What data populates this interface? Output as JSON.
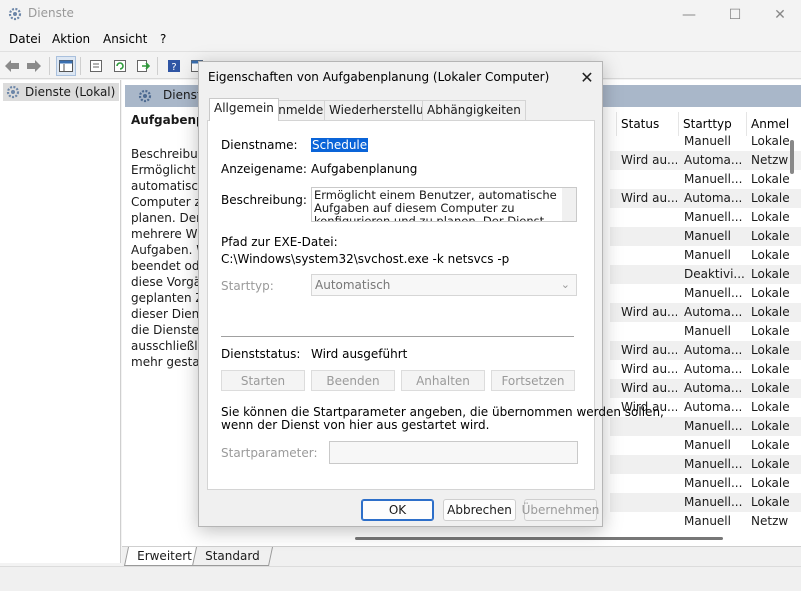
{
  "window": {
    "title": "Dienste",
    "menu": [
      "Datei",
      "Aktion",
      "Ansicht",
      "?"
    ],
    "controls": {
      "minimize": "—",
      "maximize": "☐",
      "close": "✕"
    }
  },
  "tree": {
    "item_label": "Dienste (Lokal)"
  },
  "services_pane": {
    "header": "Dienste",
    "desc_title": "Aufgabenplanung",
    "desc_lines": [
      "Beschreibung:",
      "Ermöglicht einem",
      "automatischen",
      "Computer zu konfigurieren und zu",
      "planen. Der Dienst",
      "mehrere Windows-",
      "Aufgaben. Wird",
      "beendet oder",
      "diese Vorgänge",
      "geplanten Zeiten",
      "dieser Dienst",
      "die Dienste, die",
      "ausschließlich",
      "mehr gestartet"
    ],
    "columns": [
      "Status",
      "Starttyp",
      "Anmel"
    ],
    "rows": [
      {
        "status": "",
        "starttyp": "Manuell",
        "anmel": "Lokale"
      },
      {
        "status": "Wird au...",
        "starttyp": "Automa...",
        "anmel": "Netzw"
      },
      {
        "status": "",
        "starttyp": "Manuell...",
        "anmel": "Lokale"
      },
      {
        "status": "Wird au...",
        "starttyp": "Automa...",
        "anmel": "Lokale"
      },
      {
        "status": "",
        "starttyp": "Manuell...",
        "anmel": "Lokale"
      },
      {
        "status": "",
        "starttyp": "Manuell",
        "anmel": "Lokale"
      },
      {
        "status": "",
        "starttyp": "Manuell",
        "anmel": "Lokale"
      },
      {
        "status": "",
        "starttyp": "Deaktivi...",
        "anmel": "Lokale"
      },
      {
        "status": "",
        "starttyp": "Manuell...",
        "anmel": "Lokale"
      },
      {
        "status": "Wird au...",
        "starttyp": "Automa...",
        "anmel": "Lokale"
      },
      {
        "status": "",
        "starttyp": "Manuell",
        "anmel": "Lokale"
      },
      {
        "status": "Wird au...",
        "starttyp": "Automa...",
        "anmel": "Lokale"
      },
      {
        "status": "Wird au...",
        "starttyp": "Automa...",
        "anmel": "Lokale"
      },
      {
        "status": "Wird au...",
        "starttyp": "Automa...",
        "anmel": "Lokale"
      },
      {
        "status": "Wird au...",
        "starttyp": "Automa...",
        "anmel": "Lokale"
      },
      {
        "status": "",
        "starttyp": "Manuell...",
        "anmel": "Lokale"
      },
      {
        "status": "",
        "starttyp": "Manuell",
        "anmel": "Lokale"
      },
      {
        "status": "",
        "starttyp": "Manuell...",
        "anmel": "Lokale"
      },
      {
        "status": "",
        "starttyp": "Manuell...",
        "anmel": "Lokale"
      },
      {
        "status": "",
        "starttyp": "Manuell...",
        "anmel": "Lokale"
      },
      {
        "status": "",
        "starttyp": "Manuell",
        "anmel": "Netzw"
      }
    ],
    "bottom_tabs": [
      "Erweitert",
      "Standard"
    ]
  },
  "dialog": {
    "title": "Eigenschaften von Aufgabenplanung (Lokaler Computer)",
    "close": "✕",
    "tabs": [
      "Allgemein",
      "Anmelden",
      "Wiederherstellung",
      "Abhängigkeiten"
    ],
    "dienstname_label": "Dienstname:",
    "dienstname_value": "Schedule",
    "anzeigename_label": "Anzeigename:",
    "anzeigename_value": "Aufgabenplanung",
    "beschreibung_label": "Beschreibung:",
    "beschreibung_value": "Ermöglicht einem Benutzer, automatische Aufgaben auf diesem Computer zu konfigurieren und zu planen. Der Dienst hostet auch mehrere Windows-",
    "pfad_label": "Pfad zur EXE-Datei:",
    "pfad_value": "C:\\Windows\\system32\\svchost.exe -k netsvcs -p",
    "starttyp_label": "Starttyp:",
    "starttyp_value": "Automatisch",
    "dienststatus_label": "Dienststatus:",
    "dienststatus_value": "Wird ausgeführt",
    "svc_buttons": [
      "Starten",
      "Beenden",
      "Anhalten",
      "Fortsetzen"
    ],
    "hint_line1": "Sie können die Startparameter angeben, die übernommen werden sollen,",
    "hint_line2": "wenn der Dienst von hier aus gestartet wird.",
    "startparameter_label": "Startparameter:",
    "startparameter_value": "",
    "ok": "OK",
    "abbrechen": "Abbrechen",
    "uebernehmen": "Übernehmen"
  },
  "colors": {
    "accent": "#0a64d8",
    "pane_header": "#a9b7c9"
  }
}
